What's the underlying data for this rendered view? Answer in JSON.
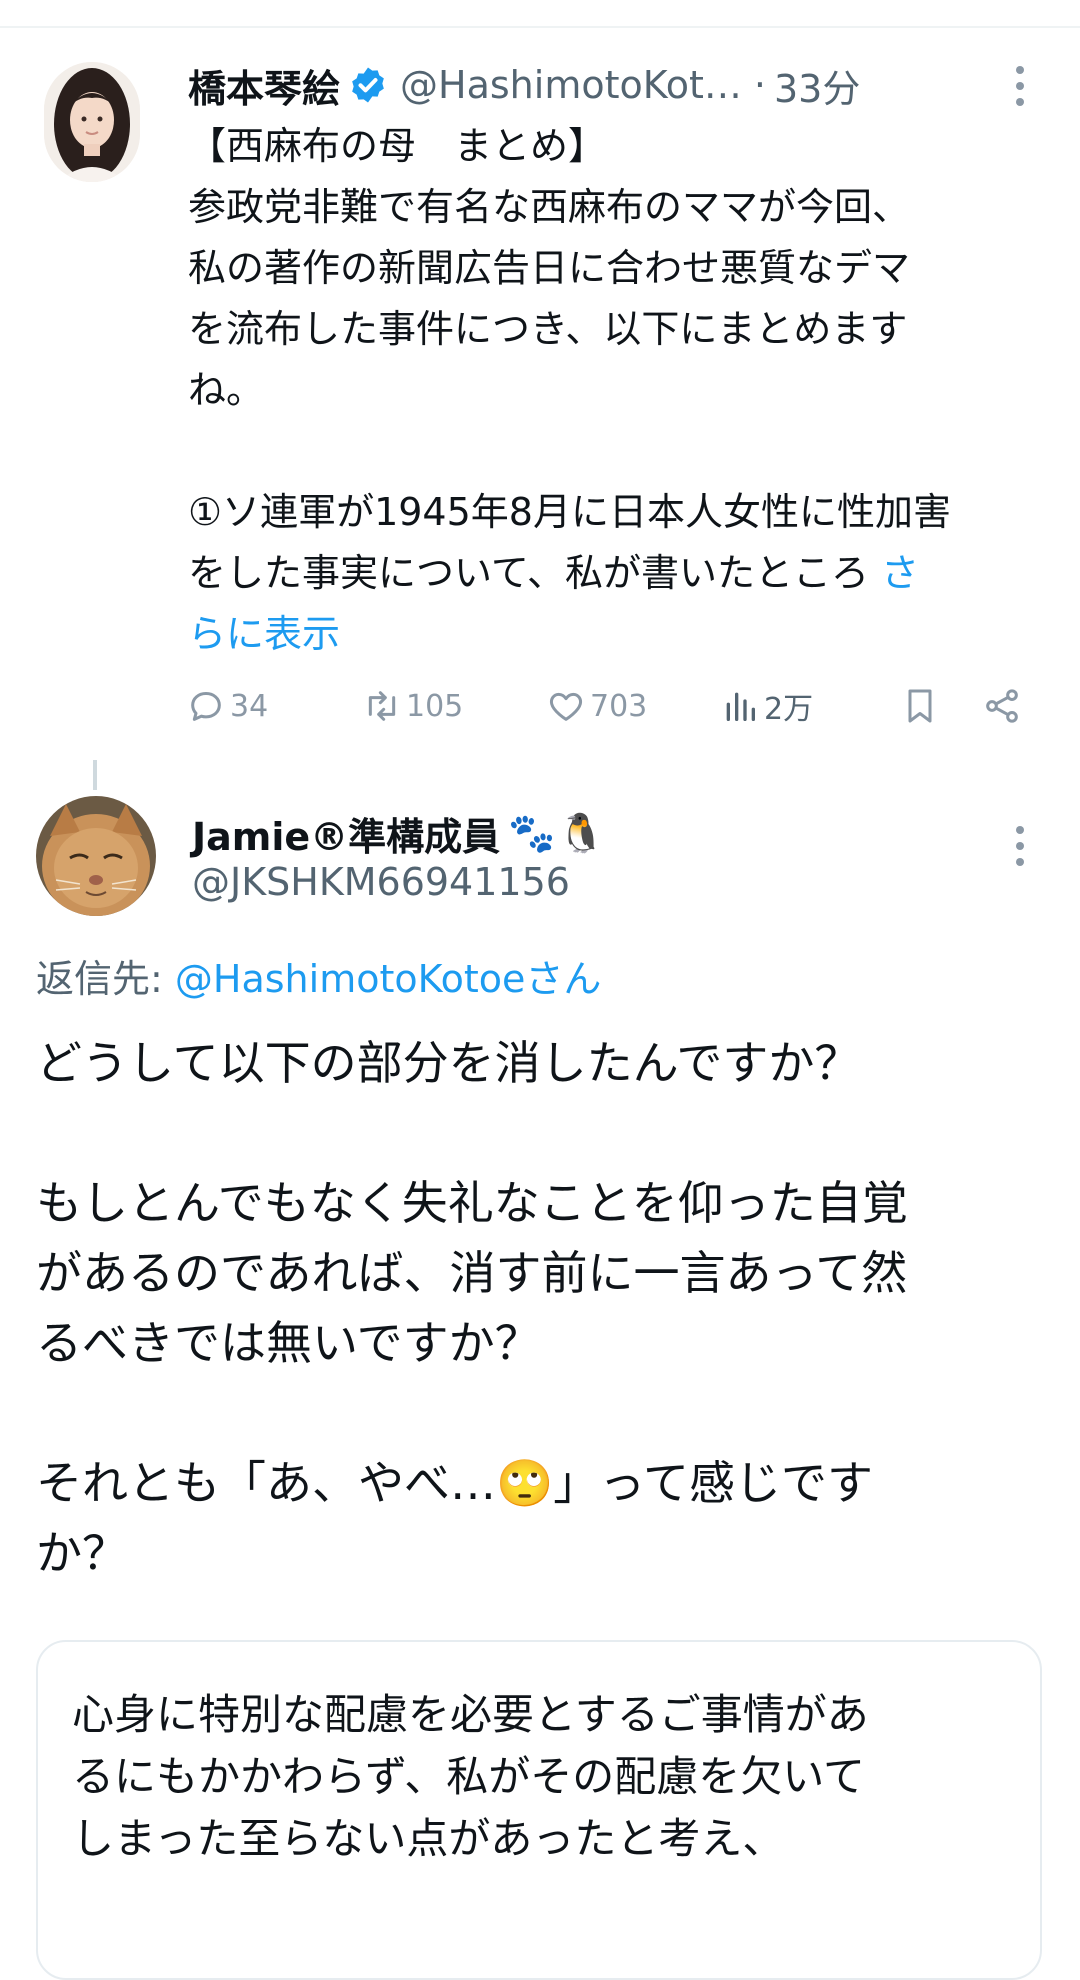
{
  "tweet": {
    "author_name": "橋本琴絵",
    "author_handle": "@HashimotoKot…",
    "separator": "·",
    "time": "33分",
    "body_text": "【西麻布の母　まとめ】\n参政党非難で有名な西麻布のママが今回、\n私の著作の新聞広告日に合わせ悪質なデマ\nを流布した事件につき、以下にまとめます\nね。\n\n①ソ連軍が1945年8月に日本人女性に性加害\nをした事実について、私が書いたところ ",
    "show_more": "さ\nらに表示",
    "stats": {
      "replies": "34",
      "retweets": "105",
      "likes": "703",
      "views": "2万"
    },
    "icons": [
      "verified-badge-icon",
      "more-icon",
      "reply-icon",
      "retweet-icon",
      "like-icon",
      "views-icon",
      "bookmark-icon",
      "share-icon"
    ],
    "colors": {
      "accent": "#1d9bf0",
      "muted": "#536471"
    }
  },
  "reply": {
    "author_name": "Jamie®準構成員",
    "author_emoji": [
      "🐾",
      "🐧"
    ],
    "author_handle": "@JKSHKM66941156",
    "reply_to_label": "返信先: ",
    "reply_to_mention": "@HashimotoKotoeさん",
    "body_text": "どうして以下の部分を消したんですか？\n\nもしとんでもなく失礼なことを仰った自覚\nがあるのであれば、消す前に一言あって然\nるべきでは無いですか？\n\nそれとも「あ、やべ…🙄」って感じです\nか？",
    "quote_text": "心身に特別な配慮を必要とするご事情があ\nるにもかかわらず、私がその配慮を欠いて\nしまった至らない点があったと考え、"
  }
}
